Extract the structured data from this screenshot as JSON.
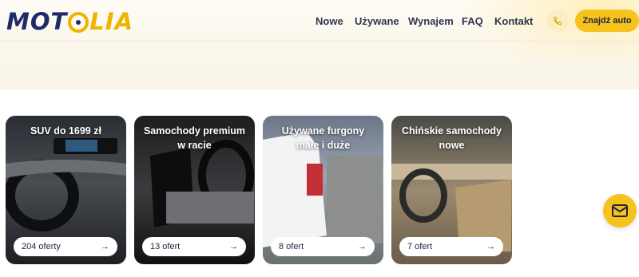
{
  "brand": {
    "part1": "MOT",
    "part2": "LIA",
    "accent": "#f6c21c",
    "primary": "#1f2a6b"
  },
  "nav": {
    "items": [
      "Nowe",
      "Używane",
      "Wynajem",
      "FAQ",
      "Kontakt"
    ]
  },
  "header": {
    "phone_icon": "phone-icon",
    "cta_label": "Znajdź auto"
  },
  "cards": [
    {
      "title": "SUV do 1699 zł",
      "count": "204 oferty"
    },
    {
      "title": "Samochody premium w racie",
      "count": "13 ofert"
    },
    {
      "title": "Używane furgony małe i duże",
      "count": "8 ofert"
    },
    {
      "title": "Chińskie samochody nowe",
      "count": "7 ofert"
    }
  ],
  "fab": {
    "icon": "mail-icon"
  }
}
